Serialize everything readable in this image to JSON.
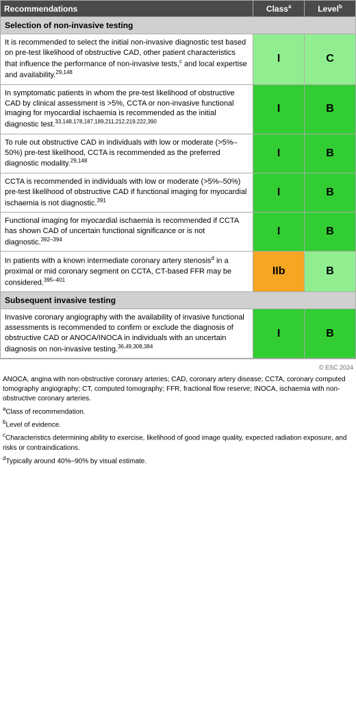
{
  "header": {
    "col_recommendations": "Recommendations",
    "col_class": "Class",
    "col_class_sup": "a",
    "col_level": "Level",
    "col_level_sup": "b"
  },
  "sections": [
    {
      "type": "section-header",
      "text": "Selection of non-invasive testing"
    },
    {
      "type": "row",
      "text": "It is recommended to select the initial non-invasive diagnostic test based on pre-test likelihood of obstructive CAD, other patient characteristics that influence the performance of non-invasive tests,",
      "text_sup1": "c",
      "text_and": " and local expertise and availability.",
      "text_sup2": "29,148",
      "class_val": "I",
      "class_color": "green-light",
      "level_val": "C",
      "level_color": "green-light"
    },
    {
      "type": "row",
      "text": "In symptomatic patients in whom the pre-test likelihood of obstructive CAD by clinical assessment is >5%, CCTA or non-invasive functional imaging for myocardial ischaemia is recommended as the initial diagnostic test.",
      "text_sup2": "33,148,178,187,189,211,212,219,222,390",
      "class_val": "I",
      "class_color": "green-medium",
      "level_val": "B",
      "level_color": "green-medium"
    },
    {
      "type": "row",
      "text": "To rule out obstructive CAD in individuals with low or moderate (>5%–50%) pre-test likelihood, CCTA is recommended as the preferred diagnostic modality.",
      "text_sup2": "29,148",
      "class_val": "I",
      "class_color": "green-medium",
      "level_val": "B",
      "level_color": "green-medium"
    },
    {
      "type": "row",
      "text": "CCTA is recommended in individuals with low or moderate (>5%–50%) pre-test likelihood of obstructive CAD if functional imaging for myocardial ischaemia is not diagnostic.",
      "text_sup2": "391",
      "class_val": "I",
      "class_color": "green-medium",
      "level_val": "B",
      "level_color": "green-medium"
    },
    {
      "type": "row",
      "text": "Functional imaging for myocardial ischaemia is recommended if CCTA has shown CAD of uncertain functional significance or is not diagnostic.",
      "text_sup2": "392–394",
      "class_val": "I",
      "class_color": "green-medium",
      "level_val": "B",
      "level_color": "green-medium"
    },
    {
      "type": "row",
      "text": "In patients with a known intermediate coronary artery stenosis",
      "text_sup_d": "d",
      "text_mid": " in a proximal or mid coronary segment on CCTA, CT-based FFR may be considered.",
      "text_sup2": "395–401",
      "class_val": "IIb",
      "class_color": "orange-cell",
      "level_val": "B",
      "level_color": "green-light"
    },
    {
      "type": "section-header",
      "text": "Subsequent invasive testing"
    },
    {
      "type": "row",
      "text": "Invasive coronary angiography with the availability of invasive functional assessments is recommended to confirm or exclude the diagnosis of obstructive CAD or ANOCA/INOCA in individuals with an uncertain diagnosis on non-invasive testing.",
      "text_sup2": "36,49,308,384",
      "class_val": "I",
      "class_color": "green-medium",
      "level_val": "B",
      "level_color": "green-medium"
    }
  ],
  "footnotes": [
    "ANOCA, angina with non-obstructive coronary arteries; CAD, coronary artery disease; CCTA, coronary computed tomography angiography; CT, computed tomography; FFR, fractional flow reserve; INOCA, ischaemia with non-obstructive coronary arteries.",
    "aClass of recommendation.",
    "bLevel of evidence.",
    "cCharacteristics determining ability to exercise, likelihood of good image quality, expected radiation exposure, and risks or contraindications.",
    "dTypically around 40%–90% by visual estimate."
  ],
  "watermark": "© ESC 2024"
}
